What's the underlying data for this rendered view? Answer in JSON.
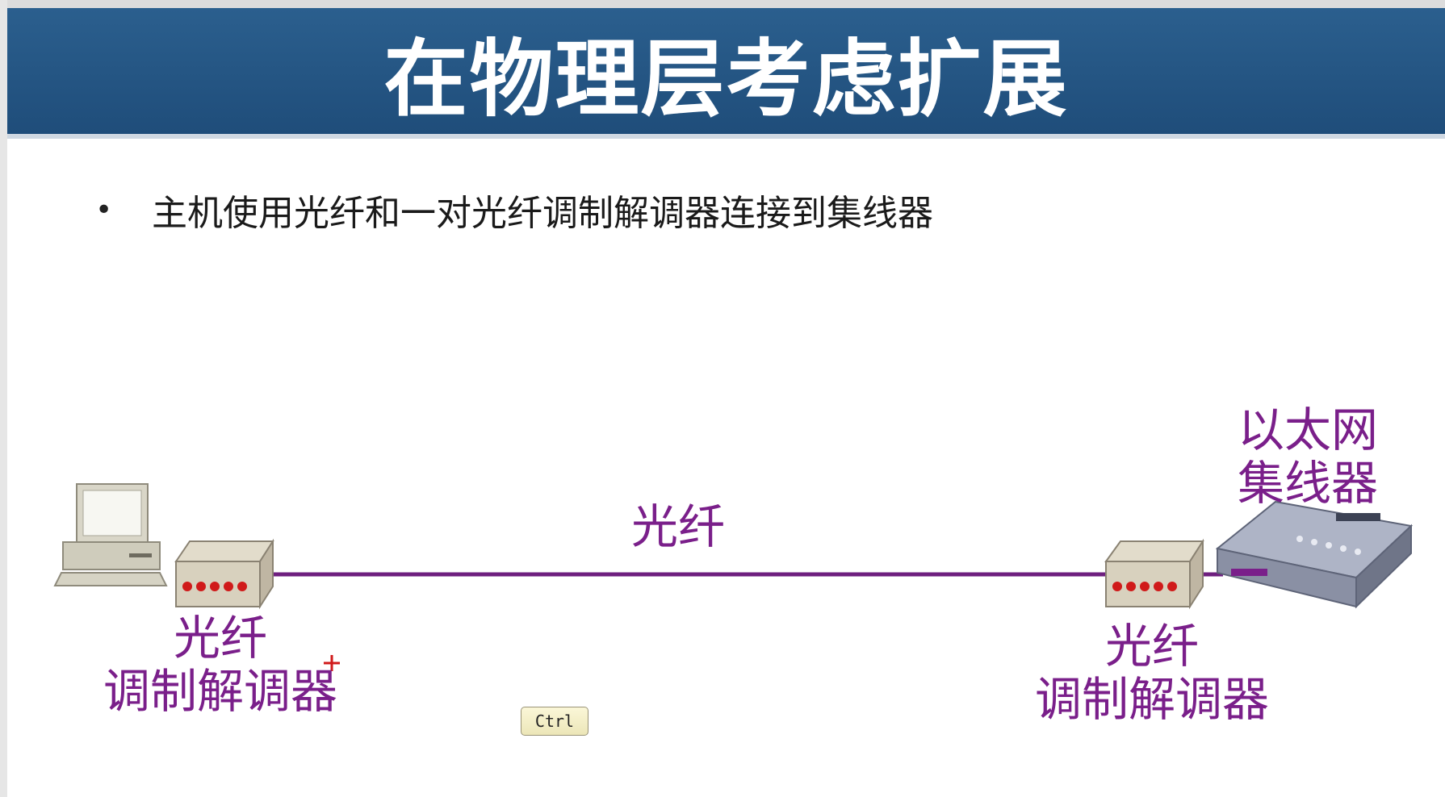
{
  "slide": {
    "title": "在物理层考虑扩展",
    "bullet": "主机使用光纤和一对光纤调制解调器连接到集线器"
  },
  "diagram": {
    "link_label": "光纤",
    "left_modem_label_line1": "光纤",
    "left_modem_label_line2": "调制解调器",
    "right_modem_label_line1": "光纤",
    "right_modem_label_line2": "调制解调器",
    "hub_label_line1": "以太网",
    "hub_label_line2": "集线器"
  },
  "overlay": {
    "ctrl_key": "Ctrl"
  },
  "colors": {
    "title_bg": "#1f4d7a",
    "label": "#7a1f8a",
    "cable": "#6e1f7f"
  }
}
